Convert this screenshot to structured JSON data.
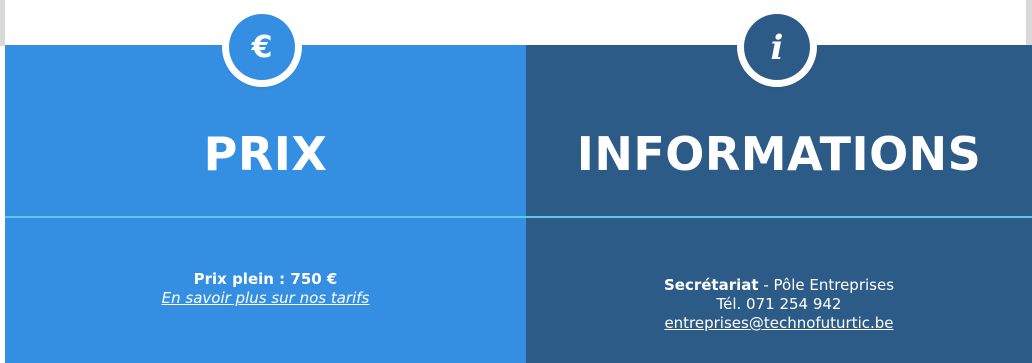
{
  "prix": {
    "icon": "euro-icon",
    "icon_glyph": "€",
    "title": "PRIX",
    "price_label": "Prix plein : 750 €",
    "tarifs_link": "En savoir plus sur nos tarifs"
  },
  "informations": {
    "icon": "info-icon",
    "icon_glyph": "i",
    "title": "INFORMATIONS",
    "contact_name": "Secrétariat",
    "contact_suffix": " - Pôle Entreprises",
    "phone": "Tél. 071 254 942",
    "email": "entreprises@technofuturtic.be"
  },
  "colors": {
    "prix_bg": "#348fe2",
    "info_bg": "#2d5b87",
    "divider": "#5fc6e8",
    "text": "#ffffff"
  }
}
